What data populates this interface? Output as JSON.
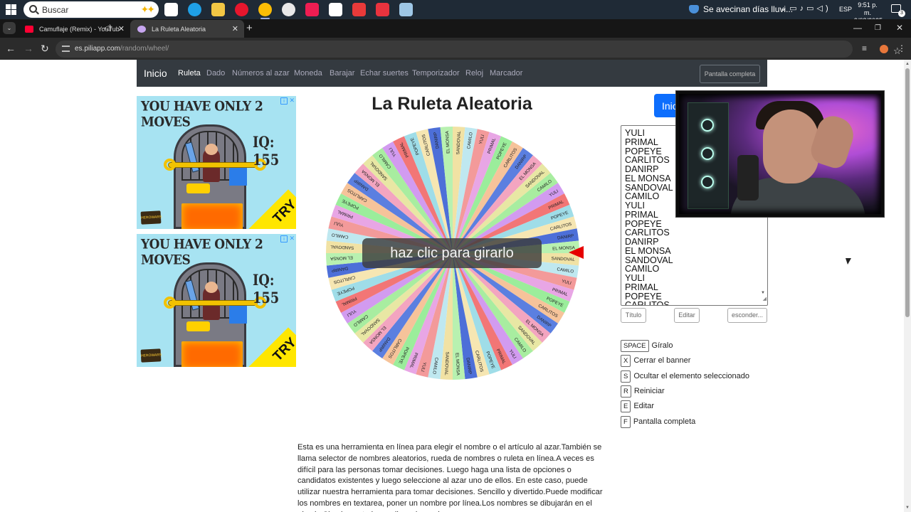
{
  "taskbar": {
    "search_placeholder": "Buscar",
    "weather_text": "Se avecinan días lluvi...",
    "language": "ESP",
    "time": "9:51 p. m.",
    "date": "9/08/2025",
    "notification_count": "3",
    "apps": [
      {
        "name": "task-view",
        "color": "#ffffff"
      },
      {
        "name": "edge",
        "color": "#1fa0e6"
      },
      {
        "name": "file-explorer",
        "color": "#f2c744"
      },
      {
        "name": "opera",
        "color": "#e6162d"
      },
      {
        "name": "chrome",
        "color": "#fbbc05"
      },
      {
        "name": "obs",
        "color": "#e8e8e8"
      },
      {
        "name": "tiktok",
        "color": "#ee1d52"
      },
      {
        "name": "capcut",
        "color": "#ffffff"
      },
      {
        "name": "tf",
        "color": "#e83a3a"
      },
      {
        "name": "fc25",
        "color": "#e8333e"
      },
      {
        "name": "app-blue",
        "color": "#9ec7e6"
      }
    ]
  },
  "browser": {
    "tabs": [
      {
        "title": "Camuflaje (Remix) - YouTub",
        "favicon_color": "#ff0033",
        "active": false
      },
      {
        "title": "La Ruleta Aleatoria",
        "favicon_color": "#c7a6f0",
        "active": true
      }
    ],
    "url_host": "es.piliapp.com",
    "url_path": "/random/wheel/"
  },
  "site": {
    "brand": "Inicio",
    "nav": [
      "Ruleta",
      "Dado",
      "Números al azar",
      "Moneda",
      "Barajar",
      "Echar suertes",
      "Temporizador",
      "Reloj",
      "Marcador"
    ],
    "fullscreen_label": "Pantalla completa",
    "title": "La Ruleta Aleatoria",
    "spin_label": "haz clic para girarlo",
    "start_label": "Inicio",
    "names": [
      "YULI",
      "PRIMAL",
      "POPEYE",
      "CARLITOS",
      "DANIRP",
      "EL MONSA",
      "SANDOVAL",
      "CAMILO",
      "YULI",
      "PRIMAL",
      "POPEYE",
      "CARLITOS",
      "DANIRP",
      "EL MONSA",
      "SANDOVAL",
      "CAMILO",
      "YULI",
      "PRIMAL",
      "POPEYE",
      "CARLITOS"
    ],
    "title_input_placeholder": "Título",
    "edit_label": "Editar",
    "hide_label": "esconder...",
    "shortcuts": [
      {
        "key": "SPACE",
        "label": "Gíralo"
      },
      {
        "key": "X",
        "label": "Cerrar el banner"
      },
      {
        "key": "S",
        "label": "Ocultar el elemento seleccionado"
      },
      {
        "key": "R",
        "label": "Reiniciar"
      },
      {
        "key": "E",
        "label": "Editar"
      },
      {
        "key": "F",
        "label": "Pantalla completa"
      }
    ],
    "description": "Esta es una herramienta en línea para elegir el nombre o el artículo al azar.También se llama selector de nombres aleatorios, rueda de nombres o ruleta en línea.A veces es difícil para las personas tomar decisiones. Luego haga una lista de opciones o candidatos existentes y luego seleccione al azar uno de ellos. En este caso, puede utilizar nuestra herramienta para tomar decisiones. Sencillo y divertido.Puede modificar los nombres en textarea, poner un nombre por línea.Los nombres se dibujarán en el círculo.Simplemente haga clic en la rueda"
  },
  "ads": [
    {
      "title": "YOU HAVE ONLY 2 MOVES",
      "iq": "IQ: 155",
      "cta": "TRY",
      "logo": "HEROWARS"
    },
    {
      "title": "YOU HAVE ONLY 2 MOVES",
      "iq": "IQ: 155",
      "cta": "TRY",
      "logo": "HEROWARS"
    }
  ],
  "wheel": {
    "segment_count": 64,
    "labels": [
      "SANDOVAL",
      "CAMILO",
      "YULI",
      "PRIMAL",
      "POPEYE",
      "CARLITOS",
      "DANIRP",
      "EL MONSA"
    ],
    "colors": [
      "#f1e2a4",
      "#bfe8f0",
      "#f39a9a",
      "#e8a6e5",
      "#9bed9b",
      "#f6c39a",
      "#5b7fe0",
      "#f3a5c0",
      "#e8e7a4",
      "#a8eda0",
      "#d29bf0",
      "#f27676",
      "#9fdde8",
      "#f6e6b2",
      "#4d6fd8",
      "#b8f1b0"
    ]
  }
}
